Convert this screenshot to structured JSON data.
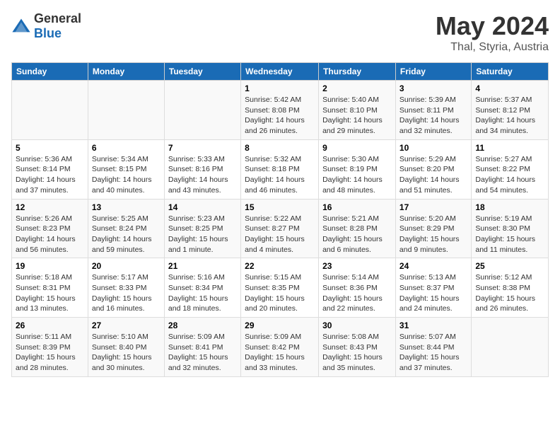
{
  "header": {
    "logo_general": "General",
    "logo_blue": "Blue",
    "title": "May 2024",
    "subtitle": "Thal, Styria, Austria"
  },
  "weekdays": [
    "Sunday",
    "Monday",
    "Tuesday",
    "Wednesday",
    "Thursday",
    "Friday",
    "Saturday"
  ],
  "weeks": [
    {
      "days": [
        {
          "num": "",
          "lines": []
        },
        {
          "num": "",
          "lines": []
        },
        {
          "num": "",
          "lines": []
        },
        {
          "num": "1",
          "lines": [
            "Sunrise: 5:42 AM",
            "Sunset: 8:08 PM",
            "Daylight: 14 hours",
            "and 26 minutes."
          ]
        },
        {
          "num": "2",
          "lines": [
            "Sunrise: 5:40 AM",
            "Sunset: 8:10 PM",
            "Daylight: 14 hours",
            "and 29 minutes."
          ]
        },
        {
          "num": "3",
          "lines": [
            "Sunrise: 5:39 AM",
            "Sunset: 8:11 PM",
            "Daylight: 14 hours",
            "and 32 minutes."
          ]
        },
        {
          "num": "4",
          "lines": [
            "Sunrise: 5:37 AM",
            "Sunset: 8:12 PM",
            "Daylight: 14 hours",
            "and 34 minutes."
          ]
        }
      ]
    },
    {
      "days": [
        {
          "num": "5",
          "lines": [
            "Sunrise: 5:36 AM",
            "Sunset: 8:14 PM",
            "Daylight: 14 hours",
            "and 37 minutes."
          ]
        },
        {
          "num": "6",
          "lines": [
            "Sunrise: 5:34 AM",
            "Sunset: 8:15 PM",
            "Daylight: 14 hours",
            "and 40 minutes."
          ]
        },
        {
          "num": "7",
          "lines": [
            "Sunrise: 5:33 AM",
            "Sunset: 8:16 PM",
            "Daylight: 14 hours",
            "and 43 minutes."
          ]
        },
        {
          "num": "8",
          "lines": [
            "Sunrise: 5:32 AM",
            "Sunset: 8:18 PM",
            "Daylight: 14 hours",
            "and 46 minutes."
          ]
        },
        {
          "num": "9",
          "lines": [
            "Sunrise: 5:30 AM",
            "Sunset: 8:19 PM",
            "Daylight: 14 hours",
            "and 48 minutes."
          ]
        },
        {
          "num": "10",
          "lines": [
            "Sunrise: 5:29 AM",
            "Sunset: 8:20 PM",
            "Daylight: 14 hours",
            "and 51 minutes."
          ]
        },
        {
          "num": "11",
          "lines": [
            "Sunrise: 5:27 AM",
            "Sunset: 8:22 PM",
            "Daylight: 14 hours",
            "and 54 minutes."
          ]
        }
      ]
    },
    {
      "days": [
        {
          "num": "12",
          "lines": [
            "Sunrise: 5:26 AM",
            "Sunset: 8:23 PM",
            "Daylight: 14 hours",
            "and 56 minutes."
          ]
        },
        {
          "num": "13",
          "lines": [
            "Sunrise: 5:25 AM",
            "Sunset: 8:24 PM",
            "Daylight: 14 hours",
            "and 59 minutes."
          ]
        },
        {
          "num": "14",
          "lines": [
            "Sunrise: 5:23 AM",
            "Sunset: 8:25 PM",
            "Daylight: 15 hours",
            "and 1 minute."
          ]
        },
        {
          "num": "15",
          "lines": [
            "Sunrise: 5:22 AM",
            "Sunset: 8:27 PM",
            "Daylight: 15 hours",
            "and 4 minutes."
          ]
        },
        {
          "num": "16",
          "lines": [
            "Sunrise: 5:21 AM",
            "Sunset: 8:28 PM",
            "Daylight: 15 hours",
            "and 6 minutes."
          ]
        },
        {
          "num": "17",
          "lines": [
            "Sunrise: 5:20 AM",
            "Sunset: 8:29 PM",
            "Daylight: 15 hours",
            "and 9 minutes."
          ]
        },
        {
          "num": "18",
          "lines": [
            "Sunrise: 5:19 AM",
            "Sunset: 8:30 PM",
            "Daylight: 15 hours",
            "and 11 minutes."
          ]
        }
      ]
    },
    {
      "days": [
        {
          "num": "19",
          "lines": [
            "Sunrise: 5:18 AM",
            "Sunset: 8:31 PM",
            "Daylight: 15 hours",
            "and 13 minutes."
          ]
        },
        {
          "num": "20",
          "lines": [
            "Sunrise: 5:17 AM",
            "Sunset: 8:33 PM",
            "Daylight: 15 hours",
            "and 16 minutes."
          ]
        },
        {
          "num": "21",
          "lines": [
            "Sunrise: 5:16 AM",
            "Sunset: 8:34 PM",
            "Daylight: 15 hours",
            "and 18 minutes."
          ]
        },
        {
          "num": "22",
          "lines": [
            "Sunrise: 5:15 AM",
            "Sunset: 8:35 PM",
            "Daylight: 15 hours",
            "and 20 minutes."
          ]
        },
        {
          "num": "23",
          "lines": [
            "Sunrise: 5:14 AM",
            "Sunset: 8:36 PM",
            "Daylight: 15 hours",
            "and 22 minutes."
          ]
        },
        {
          "num": "24",
          "lines": [
            "Sunrise: 5:13 AM",
            "Sunset: 8:37 PM",
            "Daylight: 15 hours",
            "and 24 minutes."
          ]
        },
        {
          "num": "25",
          "lines": [
            "Sunrise: 5:12 AM",
            "Sunset: 8:38 PM",
            "Daylight: 15 hours",
            "and 26 minutes."
          ]
        }
      ]
    },
    {
      "days": [
        {
          "num": "26",
          "lines": [
            "Sunrise: 5:11 AM",
            "Sunset: 8:39 PM",
            "Daylight: 15 hours",
            "and 28 minutes."
          ]
        },
        {
          "num": "27",
          "lines": [
            "Sunrise: 5:10 AM",
            "Sunset: 8:40 PM",
            "Daylight: 15 hours",
            "and 30 minutes."
          ]
        },
        {
          "num": "28",
          "lines": [
            "Sunrise: 5:09 AM",
            "Sunset: 8:41 PM",
            "Daylight: 15 hours",
            "and 32 minutes."
          ]
        },
        {
          "num": "29",
          "lines": [
            "Sunrise: 5:09 AM",
            "Sunset: 8:42 PM",
            "Daylight: 15 hours",
            "and 33 minutes."
          ]
        },
        {
          "num": "30",
          "lines": [
            "Sunrise: 5:08 AM",
            "Sunset: 8:43 PM",
            "Daylight: 15 hours",
            "and 35 minutes."
          ]
        },
        {
          "num": "31",
          "lines": [
            "Sunrise: 5:07 AM",
            "Sunset: 8:44 PM",
            "Daylight: 15 hours",
            "and 37 minutes."
          ]
        },
        {
          "num": "",
          "lines": []
        }
      ]
    }
  ]
}
